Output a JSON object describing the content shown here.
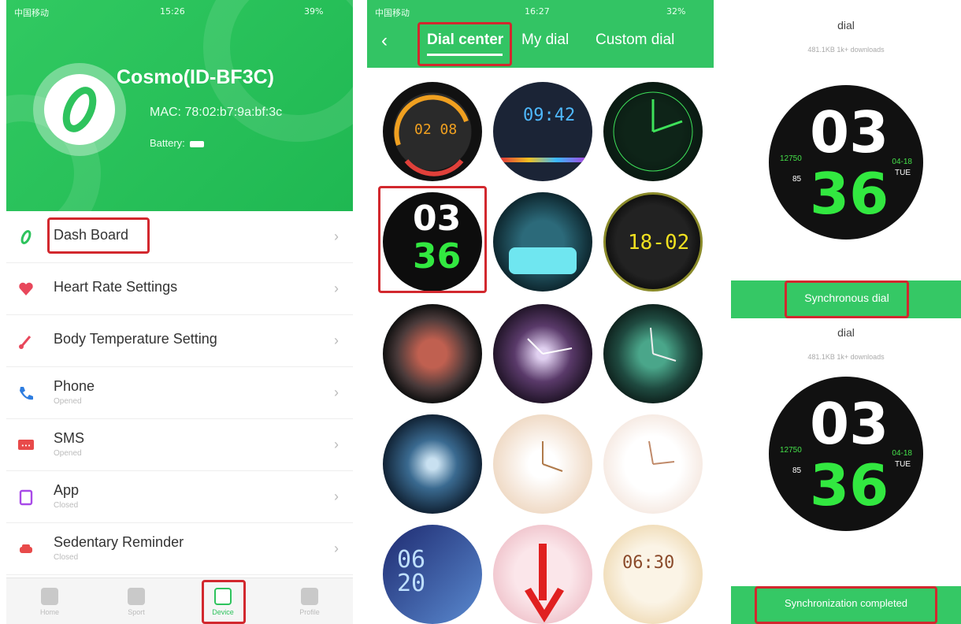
{
  "panel1": {
    "status": {
      "carrier": "中国移动",
      "time": "15:26",
      "battery": "39%"
    },
    "device": {
      "name": "Cosmo(ID-BF3C)",
      "mac": "MAC: 78:02:b7:9a:bf:3c",
      "battery_label": "Battery:"
    },
    "menu": [
      {
        "label": "Dash Board",
        "sub": ""
      },
      {
        "label": "Heart Rate Settings",
        "sub": ""
      },
      {
        "label": "Body Temperature Setting",
        "sub": ""
      },
      {
        "label": "Phone",
        "sub": "Opened"
      },
      {
        "label": "SMS",
        "sub": "Opened"
      },
      {
        "label": "App",
        "sub": "Closed"
      },
      {
        "label": "Sedentary Reminder",
        "sub": "Closed"
      }
    ],
    "tabbar": [
      {
        "label": "Home"
      },
      {
        "label": "Sport"
      },
      {
        "label": "Device"
      },
      {
        "label": "Profile"
      }
    ],
    "colors": {
      "accent": "#2ec35d",
      "highlight": "#d2282e"
    }
  },
  "panel2": {
    "status": {
      "carrier": "中国移动",
      "time": "16:27",
      "battery": "32%"
    },
    "tabs": [
      "Dial center",
      "My dial",
      "Custom dial"
    ],
    "selected_tab": "Dial center",
    "dials": [
      {
        "text": "02 08"
      },
      {
        "text": "09:42"
      },
      {
        "text": ""
      },
      {
        "text": "03 36"
      },
      {
        "text": ""
      },
      {
        "text": "18-02"
      },
      {
        "text": ""
      },
      {
        "text": ""
      },
      {
        "text": ""
      },
      {
        "text": ""
      },
      {
        "text": ""
      },
      {
        "text": ""
      },
      {
        "text": "06 20"
      },
      {
        "text": ""
      },
      {
        "text": "06:30"
      }
    ]
  },
  "panel3": {
    "top": {
      "title": "dial",
      "sub": "481.1KB  1k+ downloads"
    },
    "dial": {
      "hour": "03",
      "minute": "36",
      "steps": "12750",
      "hr": "85",
      "date": "04-18",
      "day": "TUE"
    },
    "sync_button": "Synchronous dial",
    "bottom": {
      "title": "dial",
      "sub": "481.1KB  1k+ downloads"
    },
    "completed_button": "Synchronization completed"
  }
}
